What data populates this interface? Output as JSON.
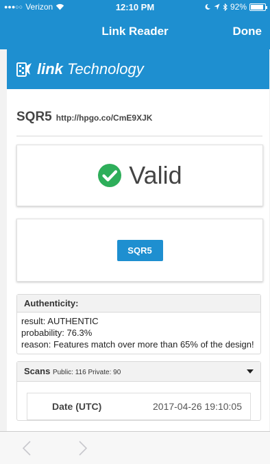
{
  "status_bar": {
    "signal_dots": "●●●○○",
    "carrier": "Verizon",
    "wifi_icon": "wifi-icon",
    "time": "12:10 PM",
    "battery": "92%",
    "battery_level": 0.92
  },
  "navbar": {
    "title": "Link Reader",
    "done_label": "Done"
  },
  "brand": {
    "name_bold": "link",
    "name_rest": " Technology",
    "accent_color": "#1e8fd0"
  },
  "result": {
    "code_label": "SQR5",
    "url": "http://hpgo.co/CmE9XJK",
    "status": "Valid",
    "status_color": "#2eae5a",
    "code_button": "SQR5"
  },
  "authenticity": {
    "title": "Authenticity:",
    "lines": [
      "result: AUTHENTIC",
      "probability: 76.3%",
      "reason: Features match over more than 65% of the design!"
    ]
  },
  "scans": {
    "title": "Scans",
    "meta": "Public: 116 Private: 90",
    "date_header": "Date (UTC)",
    "date_value": "2017-04-26 19:10:05"
  },
  "toolbar": {
    "back_icon": "chevron-left-icon",
    "forward_icon": "chevron-right-icon"
  }
}
